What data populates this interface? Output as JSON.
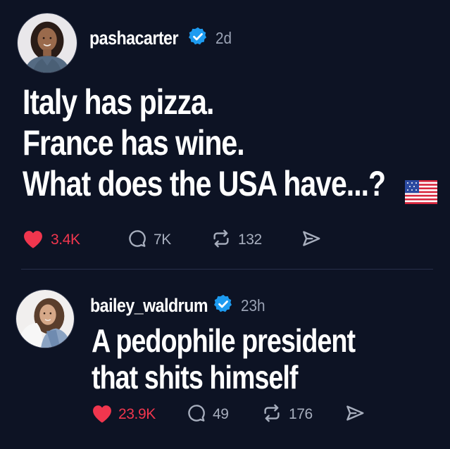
{
  "posts": [
    {
      "username": "pashacarter",
      "verified_icon": "verified-badge-icon",
      "time": "2d",
      "lines": [
        "Italy has pizza.",
        "France has wine.",
        "What does the USA have...?"
      ],
      "flag": "us-flag-icon",
      "likes": "3.4K",
      "comments": "7K",
      "reposts": "132"
    },
    {
      "username": "bailey_waldrum",
      "verified_icon": "verified-badge-icon",
      "time": "23h",
      "lines": [
        "A pedophile president",
        "that shits himself"
      ],
      "likes": "23.9K",
      "comments": "49",
      "reposts": "176"
    }
  ],
  "colors": {
    "background": "#0d1324",
    "like": "#f0364e",
    "verified": "#1d9bf0",
    "muted": "#a7aebd"
  }
}
